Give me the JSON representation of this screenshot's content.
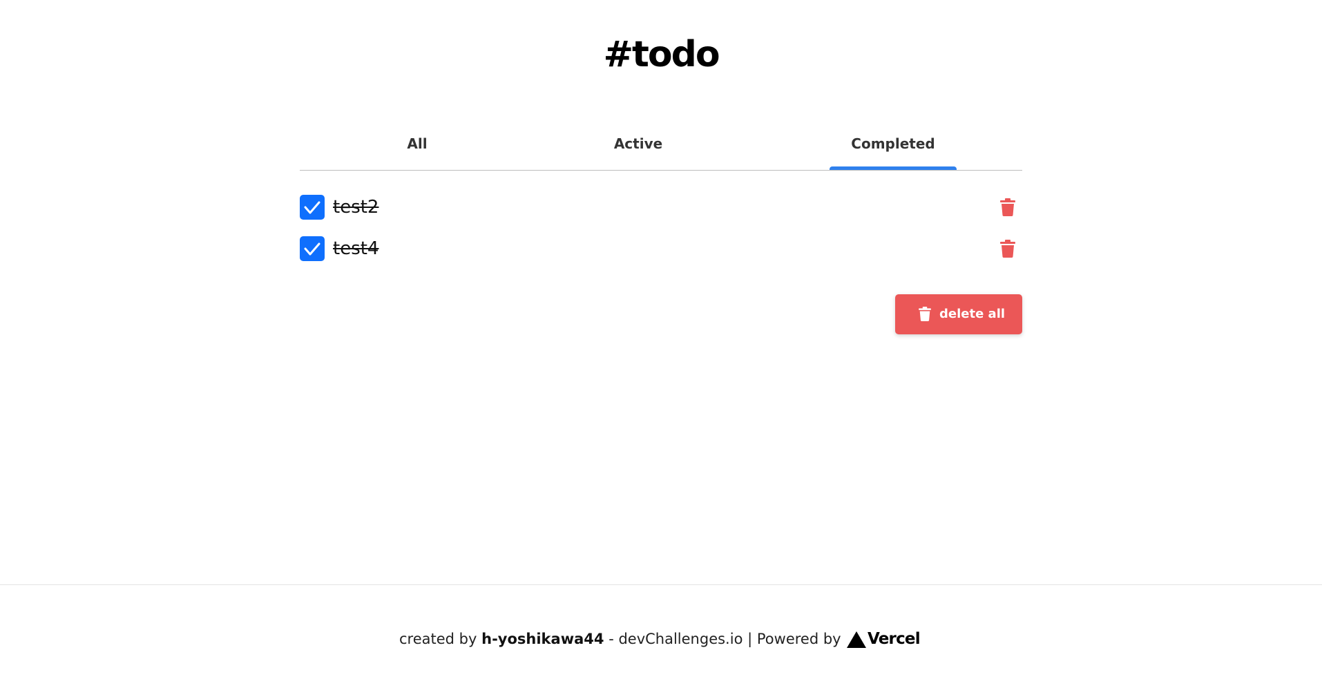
{
  "app": {
    "title": "#todo"
  },
  "tabs": [
    {
      "label": "All",
      "selected": false
    },
    {
      "label": "Active",
      "selected": false
    },
    {
      "label": "Completed",
      "selected": true
    }
  ],
  "todos": [
    {
      "text": "test2",
      "completed": true
    },
    {
      "text": "test4",
      "completed": true
    }
  ],
  "actions": {
    "delete_all_label": "delete all",
    "delete_all_icon": "trash-icon",
    "row_delete_icon": "trash-icon",
    "checkbox_icon": "checkmark-icon"
  },
  "footer": {
    "created_by_prefix": "created by",
    "author": "h-yoshikawa44",
    "separator_1": "-",
    "site": "devChallenges.io",
    "separator_2": "|",
    "powered_by": "Powered by",
    "vercel_logo_icon": "vercel-triangle-icon",
    "vercel_name": "Vercel"
  },
  "colors": {
    "accent_blue": "#2f80ed",
    "checkbox_blue": "#0f6ffd",
    "danger_red": "#eb5757",
    "divider": "#bdbdbd"
  }
}
